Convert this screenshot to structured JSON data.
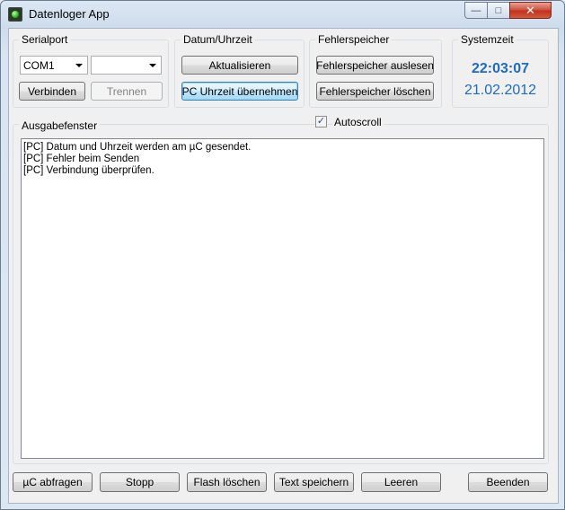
{
  "window": {
    "title": "Datenloger App",
    "minimize_label": "—",
    "maximize_label": "□",
    "close_label": "✕"
  },
  "serialport": {
    "label": "Serialport",
    "port_value": "COM1",
    "baud_value": "",
    "connect_label": "Verbinden",
    "disconnect_label": "Trennen"
  },
  "datetime": {
    "label": "Datum/Uhrzeit",
    "refresh_label": "Aktualisieren",
    "take_pc_time_label": "PC Uhrzeit übernehmen"
  },
  "errormem": {
    "label": "Fehlerspeicher",
    "read_label": "Fehlerspeicher auslesen",
    "clear_label": "Fehlerspeicher löschen"
  },
  "systime": {
    "label": "Systemzeit",
    "time": "22:03:07",
    "date": "21.02.2012"
  },
  "output": {
    "label": "Ausgabefenster",
    "autoscroll_label": "Autoscroll",
    "autoscroll_checked": true,
    "lines": [
      "[PC] Datum und Uhrzeit werden am µC gesendet.",
      "[PC] Fehler beim Senden",
      "[PC] Verbindung überprüfen."
    ]
  },
  "bottom": {
    "query_label": "µC abfragen",
    "stop_label": "Stopp",
    "flash_clear_label": "Flash löschen",
    "save_text_label": "Text speichern",
    "clear_label": "Leeren",
    "exit_label": "Beenden"
  },
  "colors": {
    "clock_text": "#1e6bbf",
    "close_button": "#c2331e"
  }
}
